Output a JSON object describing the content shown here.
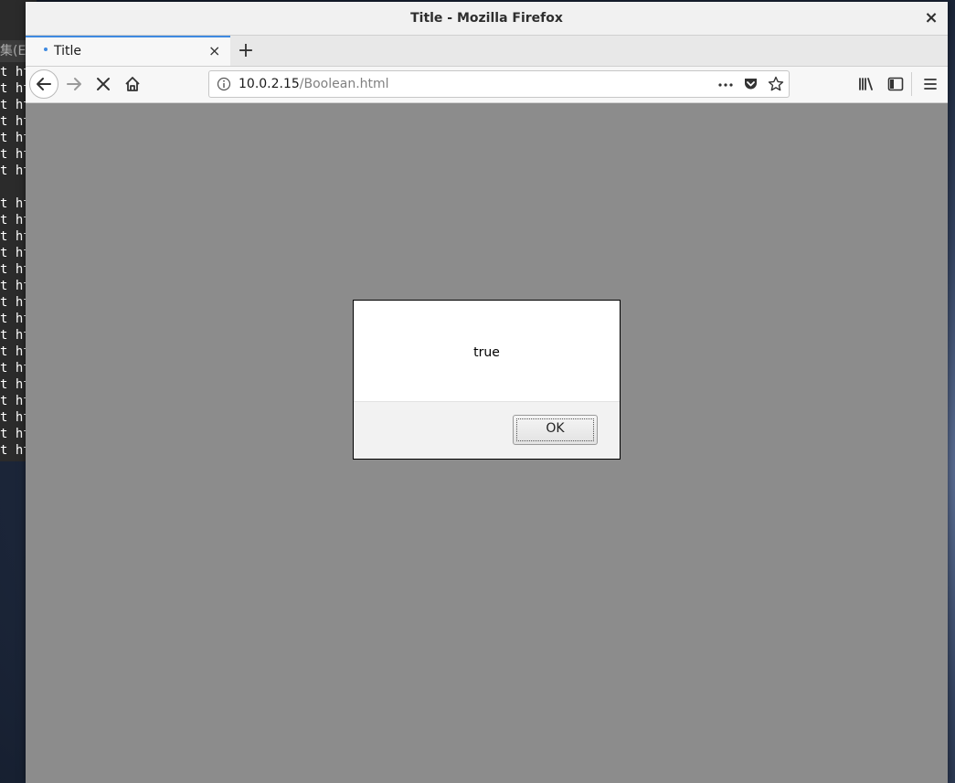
{
  "window": {
    "title": "Title - Mozilla Firefox",
    "close_glyph": "×"
  },
  "terminal": {
    "menu_text": "集(E",
    "lines_top": [
      "t ht",
      "t ht",
      "t ht",
      "t ht",
      "t ht",
      "t ht",
      "t ht"
    ],
    "lines_bottom": [
      "t ht",
      "t ht",
      "t ht",
      "t ht",
      "t ht",
      "t ht",
      "t ht",
      "t ht",
      "t ht",
      "t ht",
      "t ht",
      "t ht",
      "t ht",
      "t ht",
      "t ht",
      "t ht"
    ]
  },
  "tabs": [
    {
      "label": "Title",
      "loading": true,
      "close_glyph": "×"
    }
  ],
  "new_tab_glyph": "+",
  "urlbar": {
    "host": "10.0.2.15",
    "path": "/Boolean.html"
  },
  "icons": {
    "back": "back-arrow-icon",
    "forward": "forward-arrow-icon",
    "stop": "stop-icon",
    "home": "home-icon",
    "info": "info-icon",
    "page_actions": "more-icon",
    "pocket": "pocket-icon",
    "bookmark": "star-icon",
    "library": "library-icon",
    "sidebar": "sidebar-icon",
    "menu": "hamburger-menu-icon"
  },
  "alert": {
    "message": "true",
    "ok_label": "OK"
  },
  "colors": {
    "content_overlay": "#8c8c8c",
    "tab_accent": "#3f8ae0"
  }
}
